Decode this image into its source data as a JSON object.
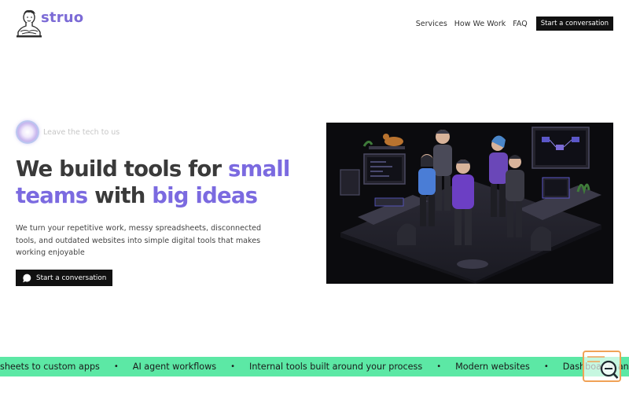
{
  "brand": {
    "name": "struo",
    "logo_icon": "bust-statue-icon",
    "accent_color": "#7b6ae0"
  },
  "nav": {
    "links": [
      "Services",
      "How We Work",
      "FAQ"
    ],
    "cta_label": "Start a conversation"
  },
  "hero": {
    "tagline": "Leave the tech to us",
    "headline": {
      "l1_plain": "We build tools for ",
      "l1_accent": "small",
      "l2_accent_a": "teams",
      "l2_plain": " with ",
      "l2_accent_b": "big ideas"
    },
    "description": "We turn your repetitive work, messy spreadsheets, disconnected tools, and outdated websites into simple digital tools that makes working enjoyable",
    "cta_label": "Start a conversation",
    "cta_icon": "chat-bubble-icon",
    "image_icon": "team-collaboration-illustration"
  },
  "ticker": {
    "background": "#5ce8a5",
    "items": [
      "sheets to custom apps",
      "AI agent workflows",
      "Internal tools built around your process",
      "Modern websites",
      "Dashboards and"
    ],
    "separator": "•"
  },
  "widget": {
    "icon": "search-icon",
    "border_color": "#f0a256"
  }
}
